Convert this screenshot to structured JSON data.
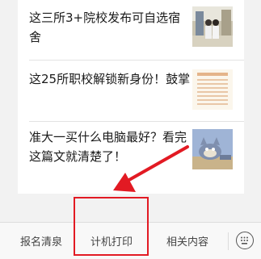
{
  "articles": [
    {
      "title": "这三所3+院校发布可自选宿舍",
      "thumb_icon": "dorm-photo-thumbnail"
    },
    {
      "title": "这25所职校解锁新身份！鼓掌",
      "thumb_icon": "document-thumbnail"
    },
    {
      "title": "准大一买什么电脑最好？看完这篇文就清楚了！",
      "thumb_icon": "cartoon-cat-thumbnail"
    }
  ],
  "menu": {
    "items": [
      {
        "label": "报名清泉"
      },
      {
        "label": "计机打印"
      },
      {
        "label": "相关内容"
      }
    ],
    "keyboard_icon": "keyboard-icon"
  },
  "colors": {
    "accent_red": "#e21a23",
    "background": "#f2f2f2"
  }
}
